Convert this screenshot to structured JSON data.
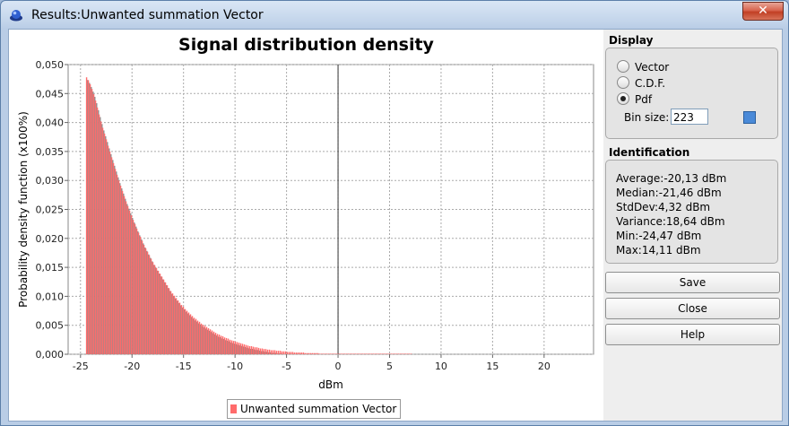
{
  "window": {
    "title": "Results:Unwanted summation Vector",
    "close_glyph": "✕"
  },
  "display": {
    "section_label": "Display",
    "options": [
      {
        "label": "Vector",
        "selected": false
      },
      {
        "label": "C.D.F.",
        "selected": false
      },
      {
        "label": "Pdf",
        "selected": true
      }
    ],
    "bin_label": "Bin size:",
    "bin_value": "223"
  },
  "identification": {
    "section_label": "Identification",
    "lines": [
      "Average:-20,13 dBm",
      "Median:-21,46 dBm",
      "StdDev:4,32 dBm",
      "Variance:18,64 dBm",
      "Min:-24,47 dBm",
      "Max:14,11 dBm"
    ]
  },
  "buttons": {
    "save": "Save",
    "close": "Close",
    "help": "Help"
  },
  "colors": {
    "bar": "#ff6b6b",
    "bar_shadow": "#888888",
    "grid": "#aaaaaa"
  },
  "chart_data": {
    "type": "bar",
    "title": "Signal distribution density",
    "xlabel": "dBm",
    "ylabel": "Probability density function (x100%)",
    "xlim": [
      -26.2,
      24.8
    ],
    "ylim": [
      0,
      0.05
    ],
    "grid": true,
    "legend_position": "bottom",
    "x_ticks": [
      "-25",
      "-20",
      "-15",
      "-10",
      "-5",
      "0",
      "5",
      "10",
      "15",
      "20"
    ],
    "y_ticks": [
      "0,000",
      "0,005",
      "0,010",
      "0,015",
      "0,020",
      "0,025",
      "0,030",
      "0,035",
      "0,040",
      "0,045",
      "0,050"
    ],
    "series": [
      {
        "name": "Unwanted summation Vector",
        "bin_width": 0.174,
        "x_start": -24.47,
        "values": [
          0.0478,
          0.0473,
          0.0466,
          0.0458,
          0.0449,
          0.0438,
          0.0426,
          0.0414,
          0.0402,
          0.0391,
          0.0381,
          0.0371,
          0.036,
          0.035,
          0.034,
          0.033,
          0.032,
          0.031,
          0.03,
          0.0291,
          0.0282,
          0.0273,
          0.0264,
          0.0256,
          0.0248,
          0.024,
          0.0232,
          0.0225,
          0.0217,
          0.021,
          0.0203,
          0.0196,
          0.0189,
          0.0183,
          0.0177,
          0.0171,
          0.0165,
          0.0159,
          0.0154,
          0.0149,
          0.0144,
          0.0139,
          0.0134,
          0.0129,
          0.0124,
          0.0119,
          0.0114,
          0.0109,
          0.0105,
          0.0101,
          0.0097,
          0.0093,
          0.0089,
          0.0085,
          0.0082,
          0.0078,
          0.0075,
          0.0072,
          0.0069,
          0.0066,
          0.0063,
          0.0061,
          0.0058,
          0.0056,
          0.0053,
          0.0051,
          0.0049,
          0.0047,
          0.0045,
          0.0043,
          0.0041,
          0.0039,
          0.0037,
          0.0035,
          0.0034,
          0.0032,
          0.0031,
          0.0029,
          0.0028,
          0.0027,
          0.0025,
          0.0024,
          0.0023,
          0.0022,
          0.0021,
          0.002,
          0.0019,
          0.0018,
          0.0017,
          0.0016,
          0.0015,
          0.0014,
          0.0014,
          0.0013,
          0.0012,
          0.0012,
          0.0011,
          0.001,
          0.001,
          0.0009,
          0.0009,
          0.0008,
          0.0008,
          0.0007,
          0.0007,
          0.0007,
          0.0006,
          0.0006,
          0.0006,
          0.0005,
          0.0005,
          0.0005,
          0.0004,
          0.0004,
          0.0004,
          0.0004,
          0.0003,
          0.0003,
          0.0003,
          0.0003,
          0.0003,
          0.0003,
          0.0002,
          0.0002,
          0.0002,
          0.0002,
          0.0002,
          0.0002,
          0.0002,
          0.0002,
          0.0001,
          0.0001,
          0.0001,
          0.0001,
          0.0001,
          0.0001,
          0.0001,
          0.0001,
          0.0001,
          0.0001,
          0.0001,
          0.0001,
          0.0001,
          0.0001,
          0.0001,
          0.0001,
          0.0001,
          0.0001,
          0.0001,
          0.0001,
          0.0001,
          0.0001,
          0.0001,
          0.0001,
          0.0001,
          0.0001,
          0.0001,
          0.0001,
          0.0001,
          0.0001,
          0.0001,
          0.0001,
          0.0001,
          0.0001,
          0.0001,
          0.0001,
          0.0001,
          0.0001,
          0.0001,
          0.0001,
          0.0001,
          0.0001,
          0.0001,
          0.0001,
          0.0001,
          0.0001,
          0.0001,
          0.0001,
          0.0001,
          0.0001,
          0.0001,
          0.0001
        ]
      }
    ]
  }
}
